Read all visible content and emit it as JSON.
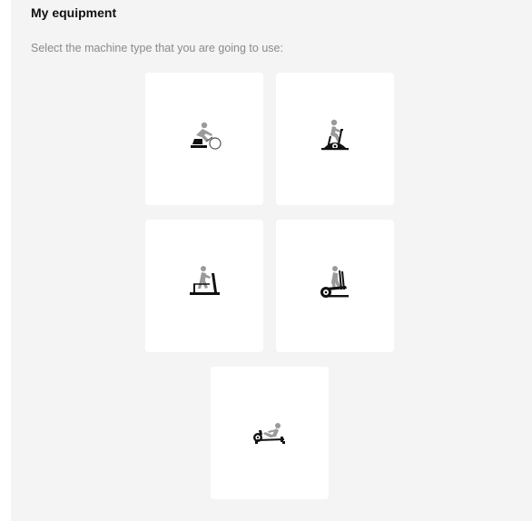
{
  "header": {
    "title": "My equipment",
    "subtitle": "Select the machine type that you are going to use:"
  },
  "machines": [
    {
      "id": "bike-trainer",
      "icon": "bike-trainer-icon"
    },
    {
      "id": "exercise-bike",
      "icon": "exercise-bike-icon"
    },
    {
      "id": "treadmill",
      "icon": "treadmill-icon"
    },
    {
      "id": "elliptical",
      "icon": "elliptical-icon"
    },
    {
      "id": "rowing-machine",
      "icon": "rowing-machine-icon"
    }
  ],
  "colors": {
    "panel_background": "#f4f4f4",
    "card_background": "#ffffff",
    "title": "#111111",
    "subtitle": "#8a8a8a",
    "icon_person": "#9a9a9a",
    "icon_machine": "#111111"
  }
}
